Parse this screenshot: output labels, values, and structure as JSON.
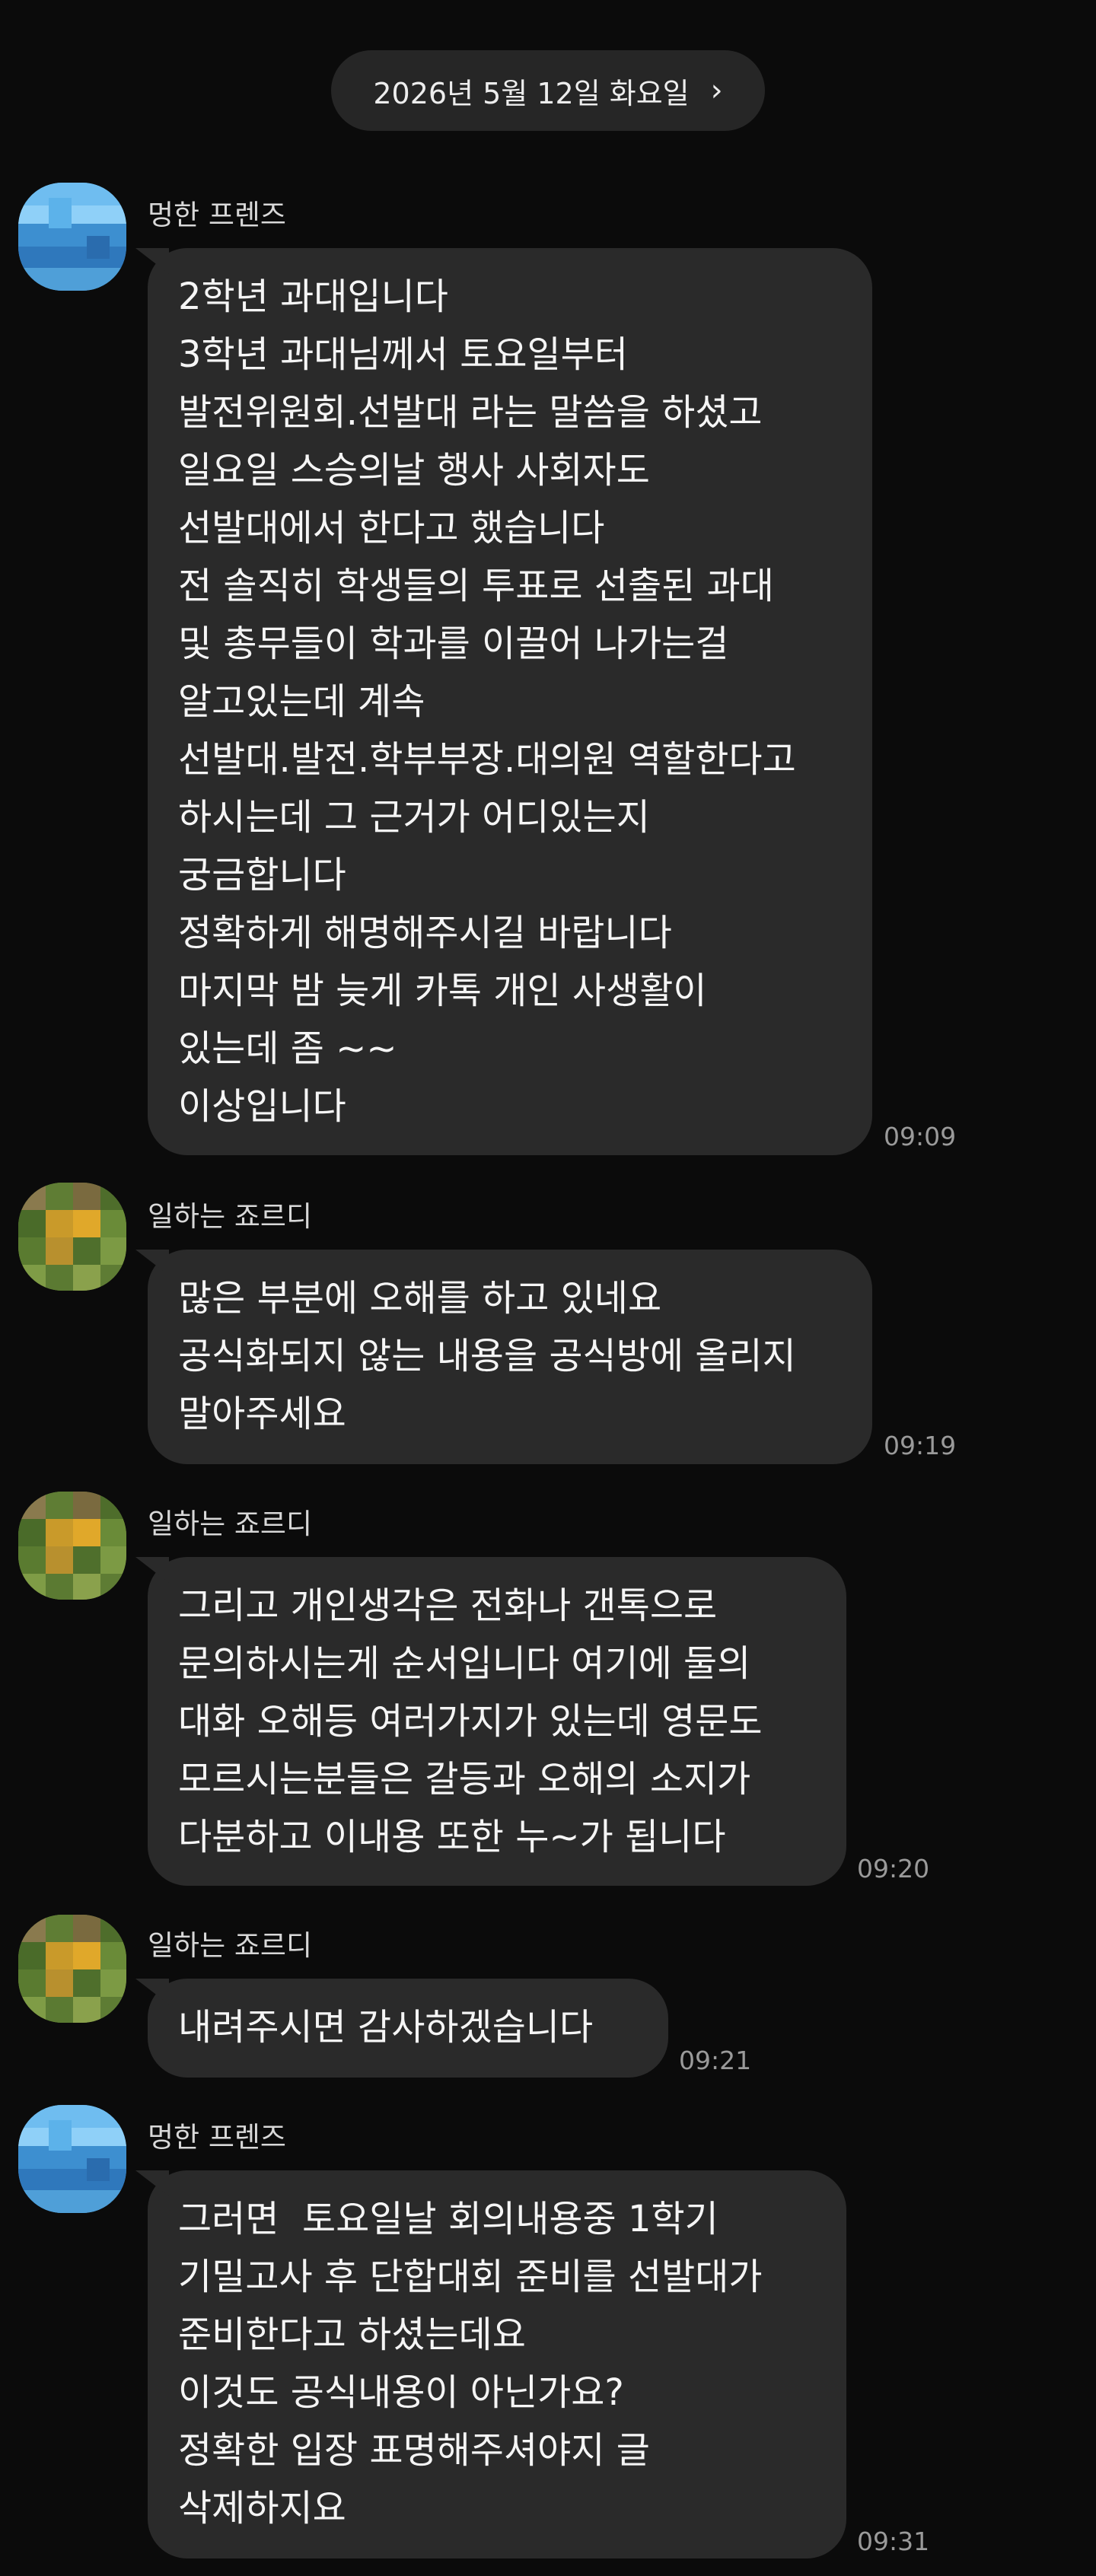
{
  "date_header": {
    "label": "2026년 5월 12일 화요일",
    "chevron": "›"
  },
  "colors": {
    "background": "#0b0b0b",
    "bubble": "#2a2a2a",
    "pill": "#262626",
    "time_text": "#9a9a9a"
  },
  "messages": [
    {
      "sender": "멍한 프렌즈",
      "avatar_icon": "blurred-blue-avatar-icon",
      "lines": [
        "2학년 과대입니다",
        "3학년 과대님께서 토요일부터",
        "발전위원회.선발대 라는 말씀을 하셨고",
        "일요일 스승의날 행사 사회자도",
        "선발대에서 한다고 했습니다",
        "전 솔직히 학생들의 투표로 선출된 과대",
        "및 총무들이 학과를 이끌어 나가는걸",
        "알고있는데 계속",
        "선발대.발전.학부부장.대의원 역할한다고",
        "하시는데 그 근거가 어디있는지",
        "궁금합니다",
        "정확하게 해명해주시길 바랍니다",
        "마지막 밤 늦게 카톡 개인 사생활이",
        "있는데 좀 ~~",
        "이상입니다"
      ],
      "time": "09:09"
    },
    {
      "sender": "일하는 죠르디",
      "avatar_icon": "blurred-green-avatar-icon",
      "lines": [
        "많은 부분에 오해를 하고 있네요",
        "공식화되지 않는 내용을 공식방에 올리지",
        "말아주세요"
      ],
      "time": "09:19"
    },
    {
      "sender": "일하는 죠르디",
      "avatar_icon": "blurred-green-avatar-icon",
      "lines": [
        "그리고 개인생각은 전화나 갠톡으로",
        "문의하시는게 순서입니다 여기에 둘의",
        "대화 오해등 여러가지가 있는데 영문도",
        "모르시는분들은 갈등과 오해의 소지가",
        "다분하고 이내용 또한 누~가 됩니다"
      ],
      "time": "09:20"
    },
    {
      "sender": "일하는 죠르디",
      "avatar_icon": "blurred-green-avatar-icon",
      "lines": [
        "내려주시면 감사하겠습니다"
      ],
      "time": "09:21"
    },
    {
      "sender": "멍한 프렌즈",
      "avatar_icon": "blurred-blue-avatar-icon",
      "lines": [
        "그러면  토요일날 회의내용중 1학기",
        "기밀고사 후 단합대회 준비를 선발대가",
        "준비한다고 하셨는데요",
        "이것도 공식내용이 아닌가요?",
        "정확한 입장 표명해주셔야지 글",
        "삭제하지요"
      ],
      "time": "09:31"
    }
  ]
}
